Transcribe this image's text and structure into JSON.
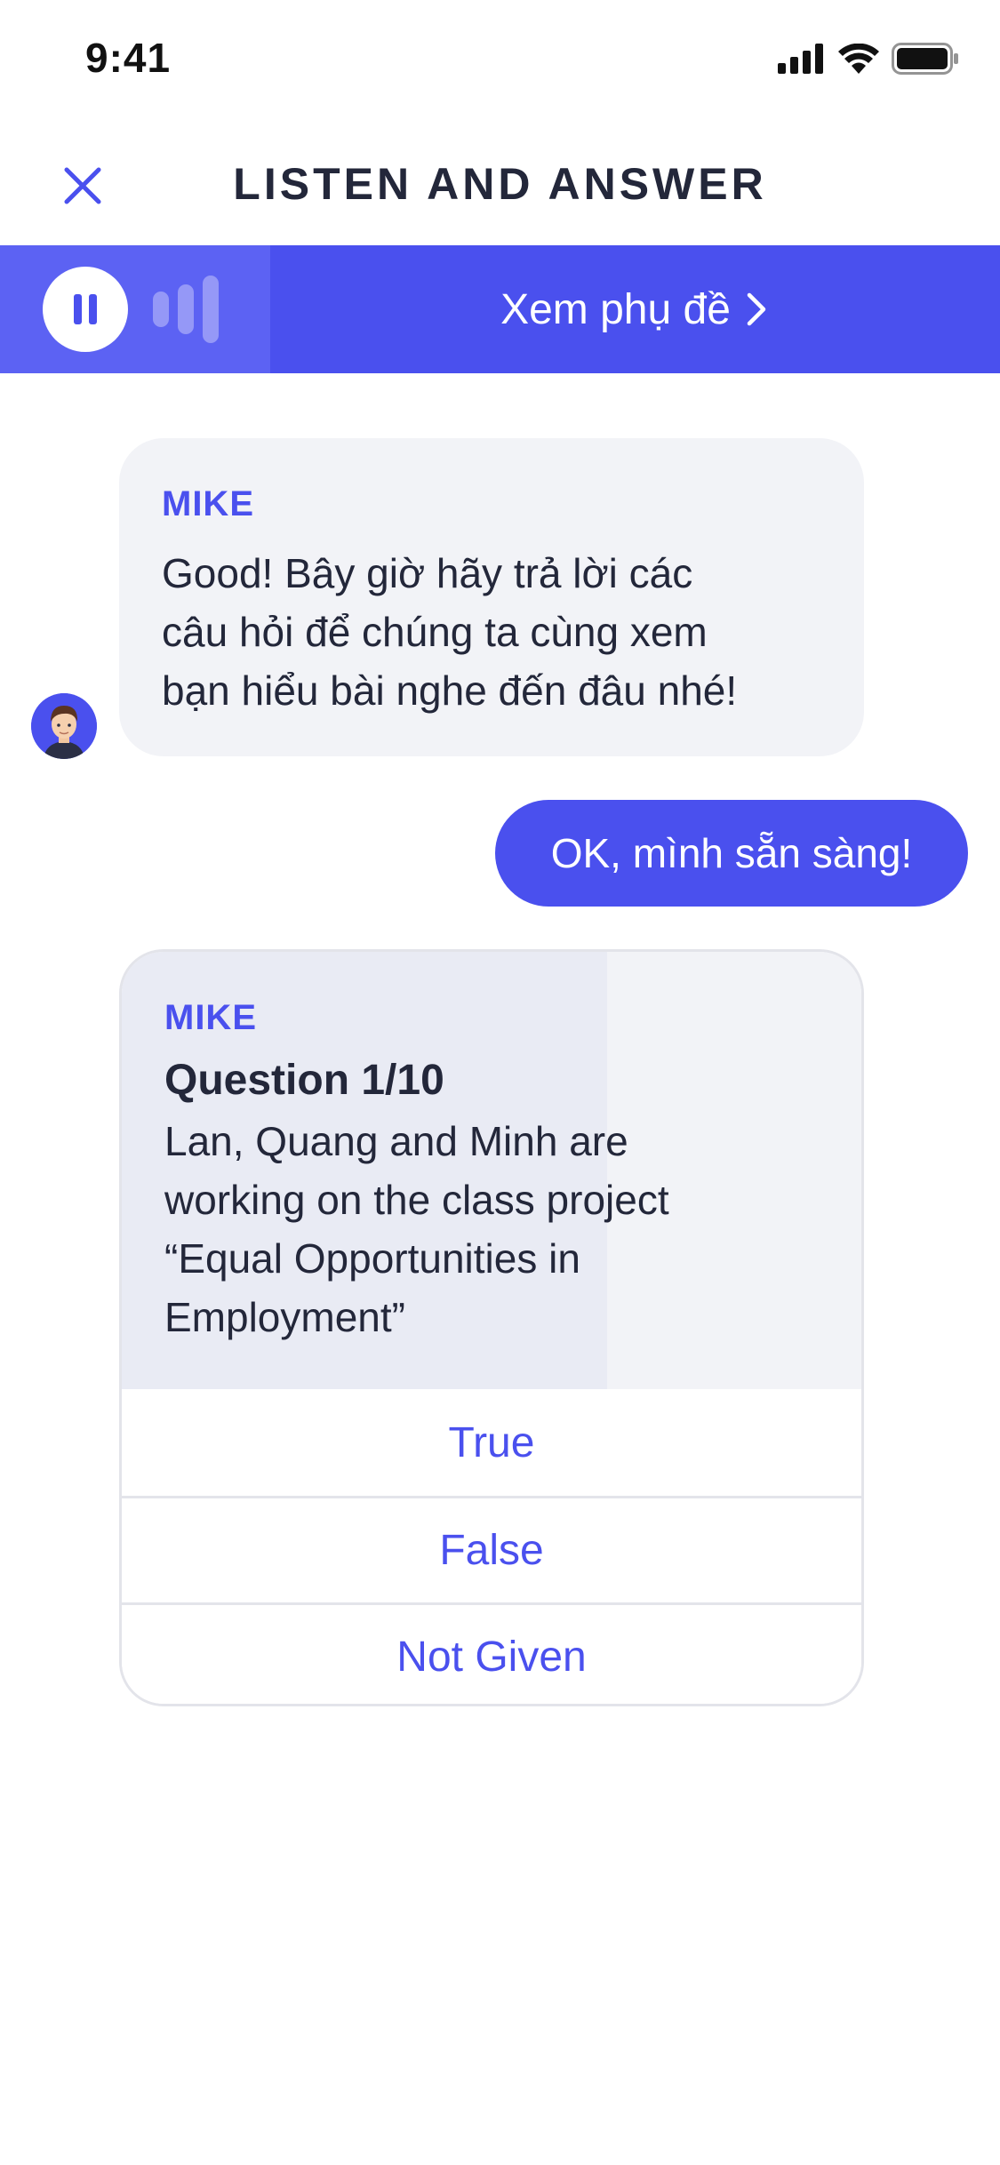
{
  "status_bar": {
    "time": "9:41",
    "icons": [
      "signal-icon",
      "wifi-icon",
      "battery-icon"
    ]
  },
  "header": {
    "title": "LISTEN AND ANSWER",
    "close_icon": "close-icon"
  },
  "audio": {
    "progress": 0.27,
    "subtitle_label": "Xem phụ đề",
    "pause_icon": "pause-icon",
    "chevron_icon": "chevron-right-icon"
  },
  "chat": {
    "bot_message": {
      "sender": "MIKE",
      "lines": [
        "Good! Bây giờ hãy trả lời các",
        "câu hỏi để chúng ta cùng xem",
        "bạn hiểu bài nghe đến đâu nhé!"
      ]
    },
    "user_message": "OK, mình sẵn sàng!",
    "question": {
      "sender": "MIKE",
      "label": "Question 1/10",
      "lines": [
        "Lan, Quang and Minh are",
        "working on the class project",
        "“Equal Opportunities in",
        "Employment”"
      ],
      "options": [
        "True",
        "False",
        "Not Given"
      ]
    }
  },
  "colors": {
    "accent": "#4a50ee",
    "bubble_bg": "#f2f3f7",
    "title_text": "#23273a"
  }
}
